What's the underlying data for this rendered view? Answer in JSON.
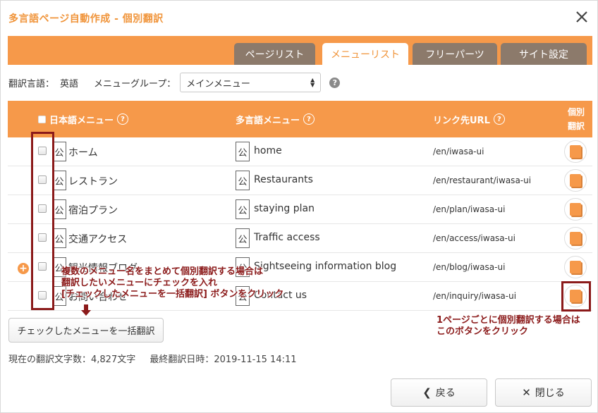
{
  "dialog": {
    "title": "多言語ページ自動作成 - 個別翻訳"
  },
  "tabs": [
    {
      "label": "ページリスト"
    },
    {
      "label": "メニューリスト"
    },
    {
      "label": "フリーパーツ"
    },
    {
      "label": "サイト設定"
    }
  ],
  "toolbar": {
    "lang_label": "翻訳言語：",
    "lang_value": "英語",
    "group_label": "メニューグループ：",
    "group_selected": "メインメニュー",
    "help": "?"
  },
  "table": {
    "headers": {
      "jp_menu": "日本語メニュー",
      "ml_menu": "多言語メニュー",
      "link_url": "リンク先URL",
      "individual_line1": "個別",
      "individual_line2": "翻訳",
      "help": "?"
    },
    "badge": "公",
    "rows": [
      {
        "jp": "ホーム",
        "en": "home",
        "url": "/en/iwasa-ui"
      },
      {
        "jp": "レストラン",
        "en": "Restaurants",
        "url": "/en/restaurant/iwasa-ui"
      },
      {
        "jp": "宿泊プラン",
        "en": "staying plan",
        "url": "/en/plan/iwasa-ui"
      },
      {
        "jp": "交通アクセス",
        "en": "Traffic access",
        "url": "/en/access/iwasa-ui"
      },
      {
        "jp": "観光情報ブログ",
        "en": "Sightseeing information blog",
        "url": "/en/blog/iwasa-ui"
      },
      {
        "jp": "お問い合わせ",
        "en": "Contact us",
        "url": "/en/inquiry/iwasa-ui"
      }
    ]
  },
  "actions": {
    "bulk_translate": "チェックしたメニューを一括翻訳",
    "back": "戻る",
    "close": "閉じる"
  },
  "info": {
    "char_count": "現在の翻訳文字数：4,827文字",
    "last_translated": "最終翻訳日時：2019-11-15 14:11"
  },
  "annotations": {
    "left_line1": "複数のメニュー名をまとめて個別翻訳する場合は",
    "left_line2": "翻訳したいメニューにチェックを入れ",
    "left_line3": "[チェックしたメニューを一括翻訳] ボタンをクリック",
    "right_line1": "1ページごとに個別翻訳する場合は",
    "right_line2": "このボタンをクリック"
  },
  "colors": {
    "accent": "#f6994a",
    "title": "#f0943a",
    "tab_inactive": "#8c7a6b",
    "annotation": "#8b1a1a"
  }
}
